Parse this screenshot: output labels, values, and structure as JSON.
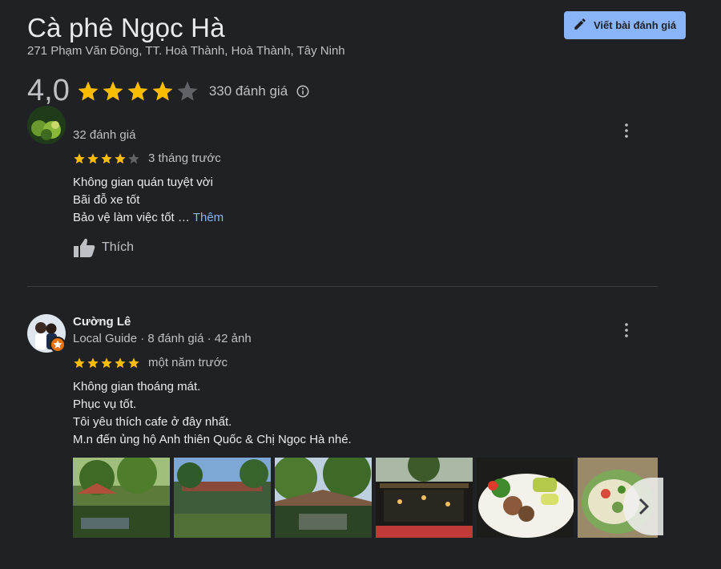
{
  "place": {
    "name": "Cà phê Ngọc Hà",
    "address": "271 Phạm Văn Đồng, TT. Hoà Thành, Hoà Thành, Tây Ninh",
    "rating": "4,0",
    "rating_stars": 4,
    "review_count_label": "330 đánh giá"
  },
  "actions": {
    "write_review_label": "Viết bài đánh giá"
  },
  "colors": {
    "accent": "#8ab4f8",
    "star": "#fbbc04",
    "star_empty": "#5f6368",
    "background": "#202124"
  },
  "reviews": [
    {
      "reviewer_meta": "32 đánh giá",
      "stars": 4,
      "time": "3 tháng trước",
      "lines": [
        "Không gian quán tuyệt vời",
        "Bãi đỗ xe tốt",
        "Bảo vệ làm việc tốt …"
      ],
      "more_label": "Thêm",
      "like_label": "Thích"
    },
    {
      "name": "Cường Lê",
      "reviewer_meta": "Local Guide · 8 đánh giá · 42 ảnh",
      "stars": 5,
      "time": "một năm trước",
      "lines": [
        "Không gian thoáng mát.",
        "Phục vụ tốt.",
        "Tôi yêu thích cafe ở đây nhất.",
        "M.n đến ủng hộ Anh thiên Quốc & Chị Ngọc Hà nhé."
      ],
      "photo_count_visible": 6
    }
  ],
  "icons": {
    "write": "pencil-icon",
    "info": "info-icon",
    "more": "more-vert-icon",
    "like": "thumb-up-icon",
    "next": "chevron-right-icon"
  }
}
